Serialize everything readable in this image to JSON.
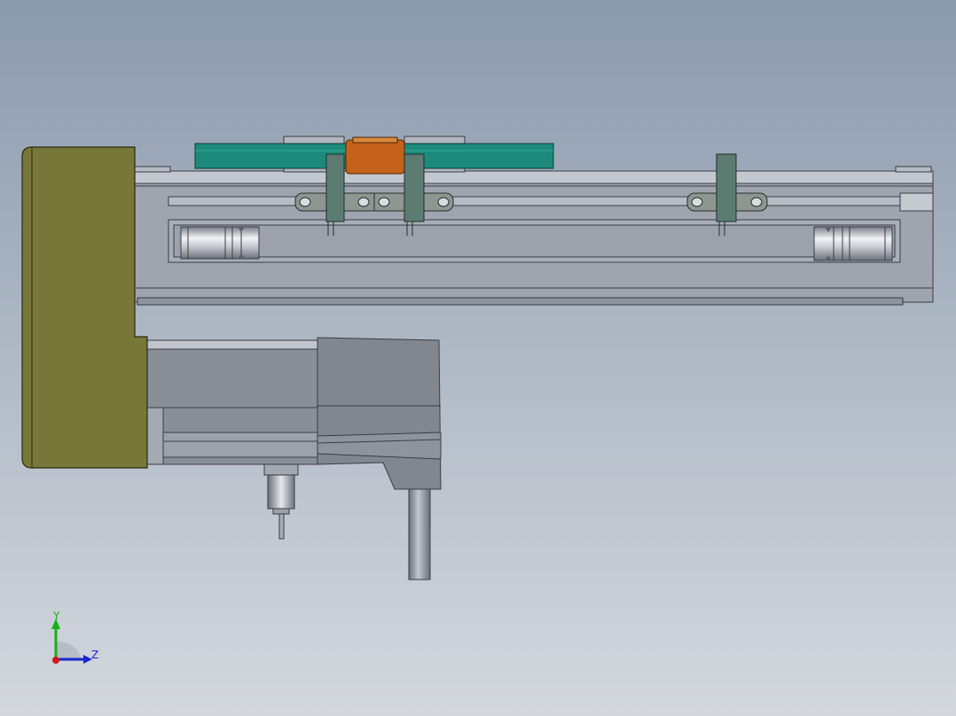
{
  "viewport": {
    "background_top": "#8b9aad",
    "background_bottom": "#d4d8de"
  },
  "model": {
    "parts": [
      "motor-flange",
      "upper-linear-rail",
      "rail-end-cap",
      "top-carriage-plate",
      "center-slider-block",
      "sensor-brackets",
      "pulley-cylinders",
      "servo-motor-body",
      "motor-gearbox-housing",
      "cable-connector",
      "output-shaft"
    ],
    "colors": {
      "flange": "#77773a",
      "rail": "#a6abb6",
      "carriage": "#1c8a7a",
      "slider": "#c4621c",
      "bracket": "#5c7c72",
      "motor": "#8a909c"
    }
  },
  "triad": {
    "y_label": "Y",
    "z_label": "Z",
    "y_color": "#18b018",
    "z_color": "#1828d0",
    "x_color": "#d01818"
  }
}
